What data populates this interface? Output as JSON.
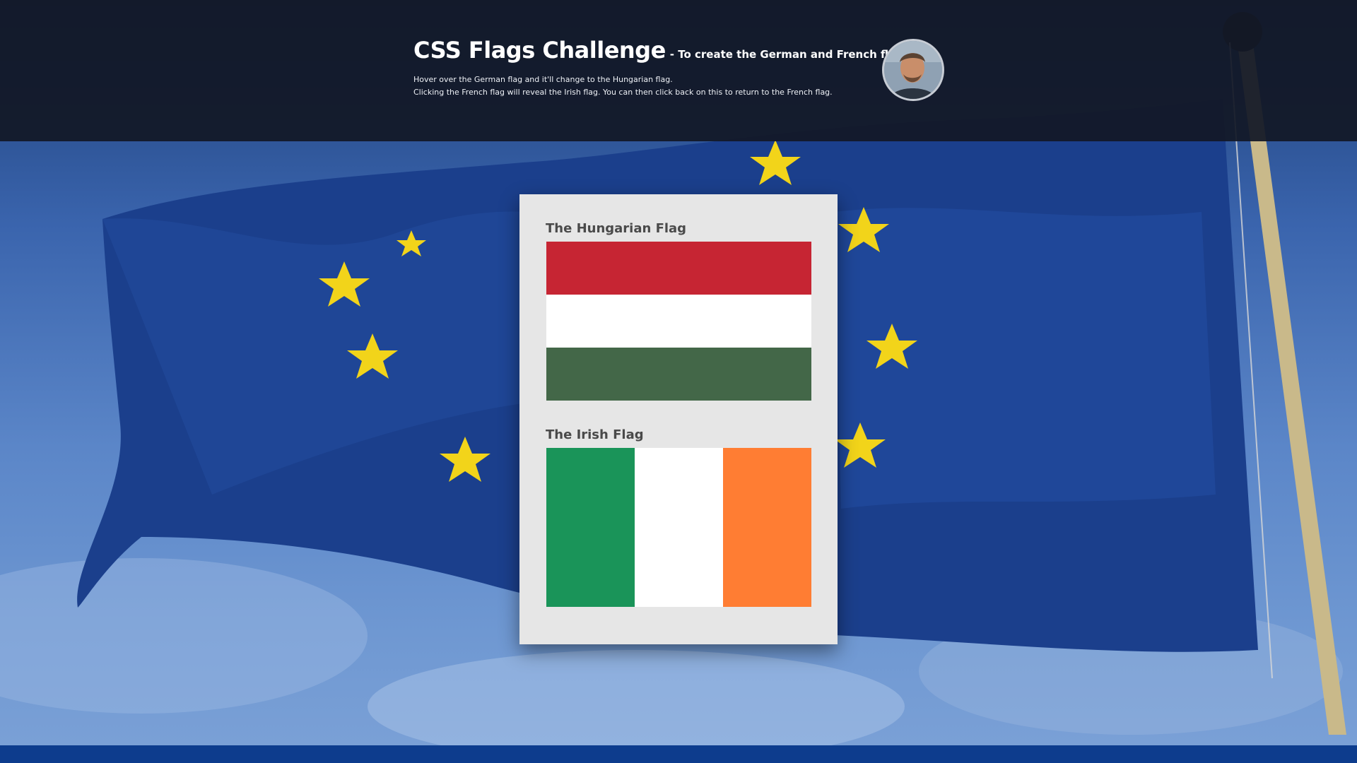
{
  "header": {
    "title": "CSS Flags Challenge",
    "subtitle": "- To create the German and French flags.",
    "line1": "Hover over the German flag and it'll change to the Hungarian flag.",
    "line2": "Clicking the French flag will reveal the Irish flag. You can then click back on this to return to the French flag."
  },
  "card": {
    "hungarian": {
      "title": "The Hungarian Flag",
      "colors": [
        "#c62533",
        "#ffffff",
        "#436748"
      ]
    },
    "irish": {
      "title": "The Irish Flag",
      "colors": [
        "#1a9459",
        "#ffffff",
        "#ff7d33"
      ]
    }
  },
  "background": {
    "flag_color": "#1b3f8c",
    "star_color": "#f2d41a",
    "footer_color": "#0d3c8d"
  }
}
